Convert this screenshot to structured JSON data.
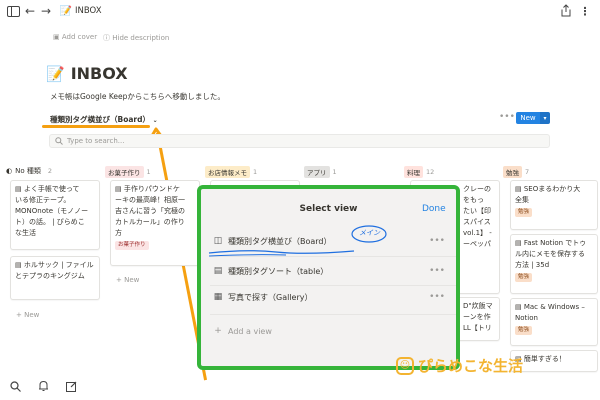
{
  "page": {
    "title": "INBOX",
    "add_cover": "Add cover",
    "hide_description": "Hide description",
    "description": "メモ帳はGoogle Keepからこちらへ移動しました。",
    "view_name": "種類別タグ横並び（Board）",
    "search_placeholder": "Type to search...",
    "new_label": "New"
  },
  "colors": {
    "accent": "#2383e2",
    "highlight": "#f5a011",
    "frame": "#35b43a"
  },
  "columns": [
    {
      "label": "No 種類",
      "count": "2",
      "color": "#ffffff"
    },
    {
      "label": "お菓子作り",
      "count": "1",
      "color": "#fbe4e4"
    },
    {
      "label": "お店情報メモ",
      "count": "1",
      "color": "#fdecc8"
    },
    {
      "label": "アプリ",
      "count": "1",
      "color": "#e3e2e0"
    },
    {
      "label": "料理",
      "count": "12",
      "color": "#ffe2dd"
    },
    {
      "label": "勉強",
      "count": "7",
      "color": "#fadec9"
    }
  ],
  "cards": {
    "c1": {
      "line1": "よく手帳で使って",
      "line2": "いる修正テープ。",
      "line3": "MONOnote（モノノー",
      "line4": "ト）の話。 | ぴらめこ",
      "line5": "な生活"
    },
    "c2": {
      "line1": "ホルサック | ファイル",
      "line2": "とテプラのキングジム"
    },
    "c3": {
      "line1": "手作りパウンドケ",
      "line2": "ーキの最高峰！相原一",
      "line3": "吉さんに習う「究極の",
      "line4": "カトルカール」の作り",
      "line5": "方",
      "tag": "お菓子作り"
    },
    "c4": {
      "line1": "クレーの",
      "line2": "をもっ",
      "line3": "たい【印",
      "line4": "スパイス",
      "line5": "vol.1】 -",
      "line6": "ーペッパ"
    },
    "c5": {
      "line1": "D\"炊飯マ",
      "line2": "ーンを作",
      "line3": "LL【トリ"
    },
    "c6": {
      "line1": "SEOまるわかり大",
      "line2": "全集",
      "tag": "勉強"
    },
    "c7": {
      "line1": "Fast Notion でトゥ",
      "line2": "ル内にメモを保存する",
      "line3": "方法 | 35d",
      "tag": "勉強"
    },
    "c8": {
      "line1": "Mac & Windows –",
      "line2": "Notion",
      "tag": "勉強"
    },
    "c9": {
      "line1": "簡単すぎる！"
    }
  },
  "plus_new": "New",
  "modal": {
    "title": "Select view",
    "done": "Done",
    "views": [
      "種類別タグ横並び（Board）",
      "種類別タグソート（table）",
      "写真で探す（Gallery）"
    ],
    "add_view": "Add a view",
    "annotation": "メイン",
    "more": "•••"
  },
  "watermark": "ぴらめこな生活",
  "icons": [
    "sidebar-icon",
    "back-arrow-icon",
    "forward-arrow-icon",
    "memo-icon",
    "share-icon",
    "more-icon",
    "search-icon",
    "bell-icon",
    "compose-icon",
    "board-icon",
    "table-icon",
    "gallery-icon",
    "plus-icon"
  ]
}
